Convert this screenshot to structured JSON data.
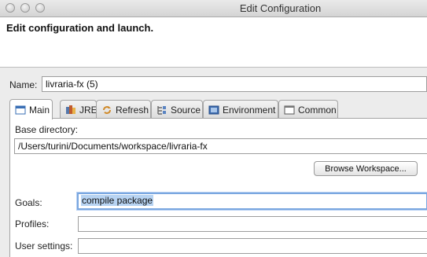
{
  "window": {
    "title": "Edit Configuration"
  },
  "header": {
    "title": "Edit configuration and launch."
  },
  "name_row": {
    "label": "Name:",
    "value": "livraria-fx (5)"
  },
  "tabs": [
    {
      "label": "Main",
      "icon": "main-tab-icon",
      "active": true
    },
    {
      "label": "JRE",
      "icon": "jre-icon"
    },
    {
      "label": "Refresh",
      "icon": "refresh-icon"
    },
    {
      "label": "Source",
      "icon": "source-icon"
    },
    {
      "label": "Environment",
      "icon": "environment-icon"
    },
    {
      "label": "Common",
      "icon": "common-icon"
    }
  ],
  "main": {
    "base_dir_label": "Base directory:",
    "base_dir_value": "/Users/turini/Documents/workspace/livraria-fx",
    "browse_button": "Browse Workspace...",
    "goals_label": "Goals:",
    "goals_value": "compile package",
    "profiles_label": "Profiles:",
    "profiles_value": "",
    "user_settings_label": "User settings:",
    "user_settings_value": ""
  },
  "colors": {
    "focus": "#7aa7e0",
    "selection": "#b7d3f2"
  }
}
